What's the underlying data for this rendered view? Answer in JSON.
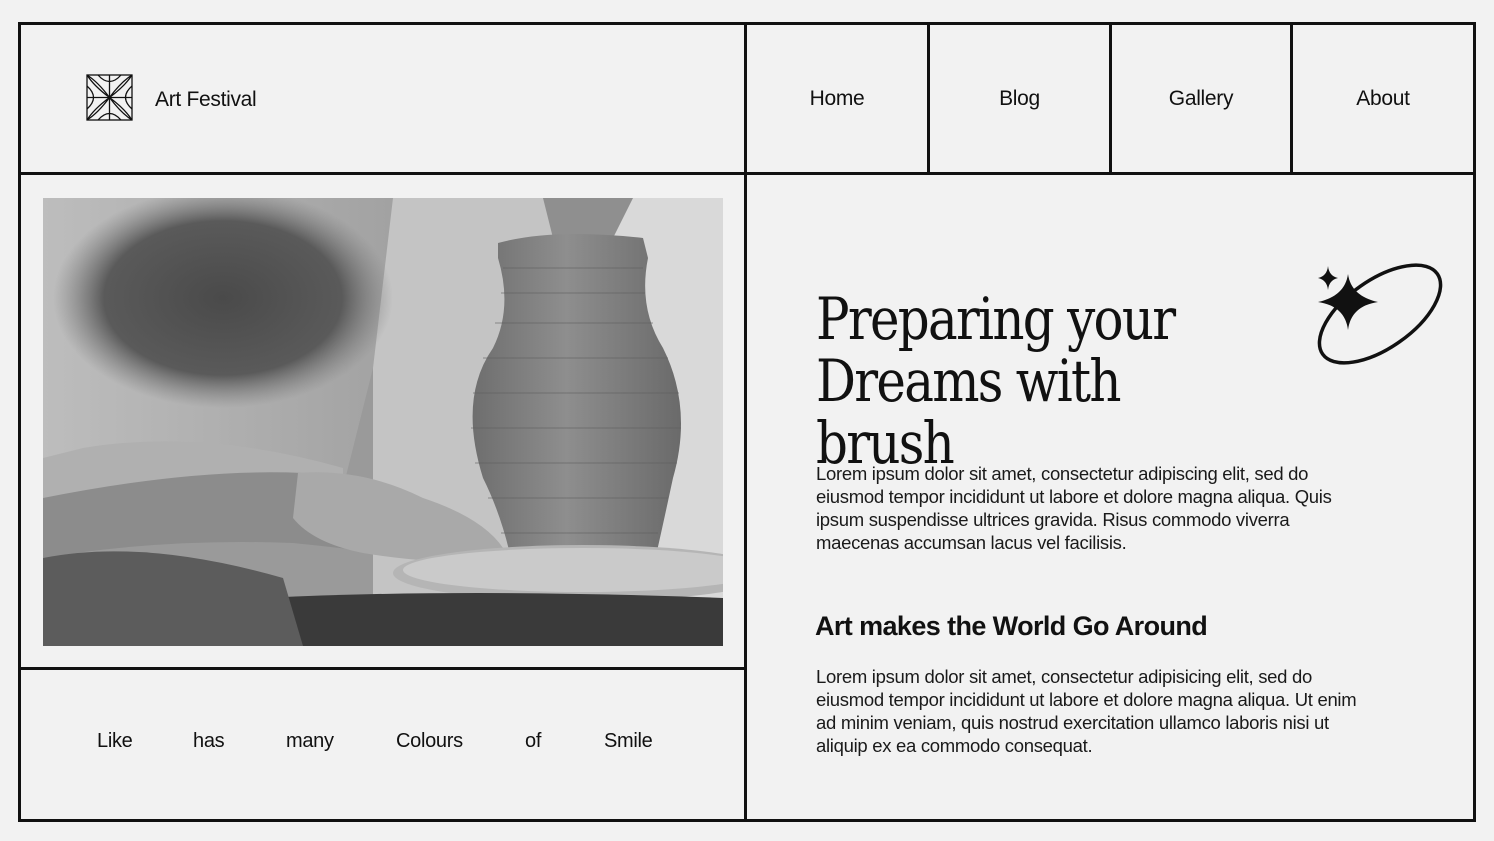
{
  "brand": {
    "name": "Art Festival",
    "logo_icon": "flower-grid-icon"
  },
  "nav": {
    "items": [
      {
        "label": "Home"
      },
      {
        "label": "Blog"
      },
      {
        "label": "Gallery"
      },
      {
        "label": "About"
      }
    ]
  },
  "hero_image": {
    "subject": "potter-at-wheel-image"
  },
  "word_strip": [
    "Like",
    "has",
    "many",
    "Colours",
    "of",
    "Smile"
  ],
  "hero": {
    "title": "Preparing your\nDreams with brush",
    "paragraph1": "Lorem ipsum dolor sit amet, consectetur adipiscing elit, sed do eiusmod tempor incididunt ut labore et dolore magna aliqua. Quis ipsum suspendisse ultrices gravida. Risus commodo viverra maecenas accumsan lacus vel facilisis.",
    "subtitle": "Art makes the World Go Around",
    "paragraph2": "Lorem ipsum dolor sit amet, consectetur adipisicing elit, sed do eiusmod tempor incididunt ut labore et dolore magna aliqua. Ut enim ad minim veniam, quis nostrud exercitation ullamco laboris nisi ut aliquip ex ea commodo consequat."
  },
  "decor": {
    "icon": "sparkle-orbit-icon"
  },
  "colors": {
    "background": "#f2f2f2",
    "ink": "#111111"
  }
}
